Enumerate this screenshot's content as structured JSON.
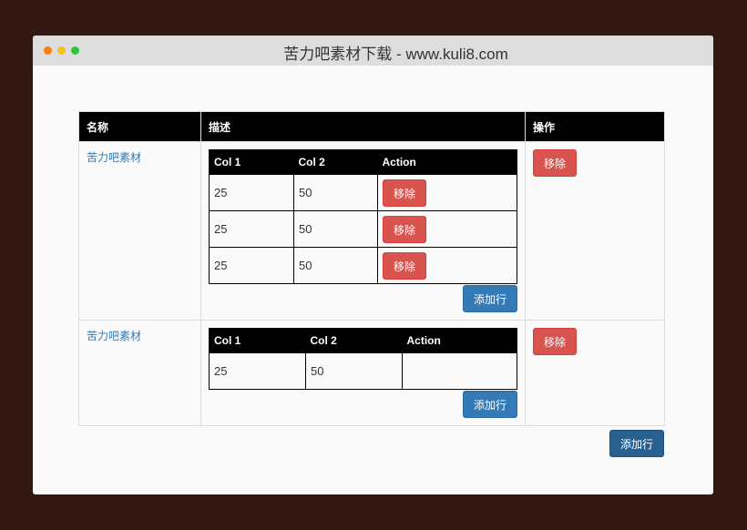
{
  "window": {
    "title": "苦力吧素材下载 - www.kuli8.com",
    "dots": [
      "#f6800b",
      "#f2c31a",
      "#2fc23b"
    ]
  },
  "table": {
    "headers": [
      "名称",
      "描述",
      "操作"
    ],
    "rows": [
      {
        "name": "苦力吧素材",
        "inner": {
          "headers": [
            "Col 1",
            "Col 2",
            "Action"
          ],
          "rows": [
            [
              "25",
              "50",
              "移除"
            ],
            [
              "25",
              "50",
              "移除"
            ],
            [
              "25",
              "50",
              "移除"
            ]
          ]
        },
        "add_label": "添加行",
        "remove_label": "移除"
      },
      {
        "name": "苦力吧素材",
        "inner": {
          "headers": [
            "Col 1",
            "Col 2",
            "Action"
          ],
          "rows": [
            [
              "25",
              "50",
              ""
            ]
          ]
        },
        "add_label": "添加行",
        "remove_label": "移除"
      }
    ]
  },
  "add_row_label": "添加行"
}
